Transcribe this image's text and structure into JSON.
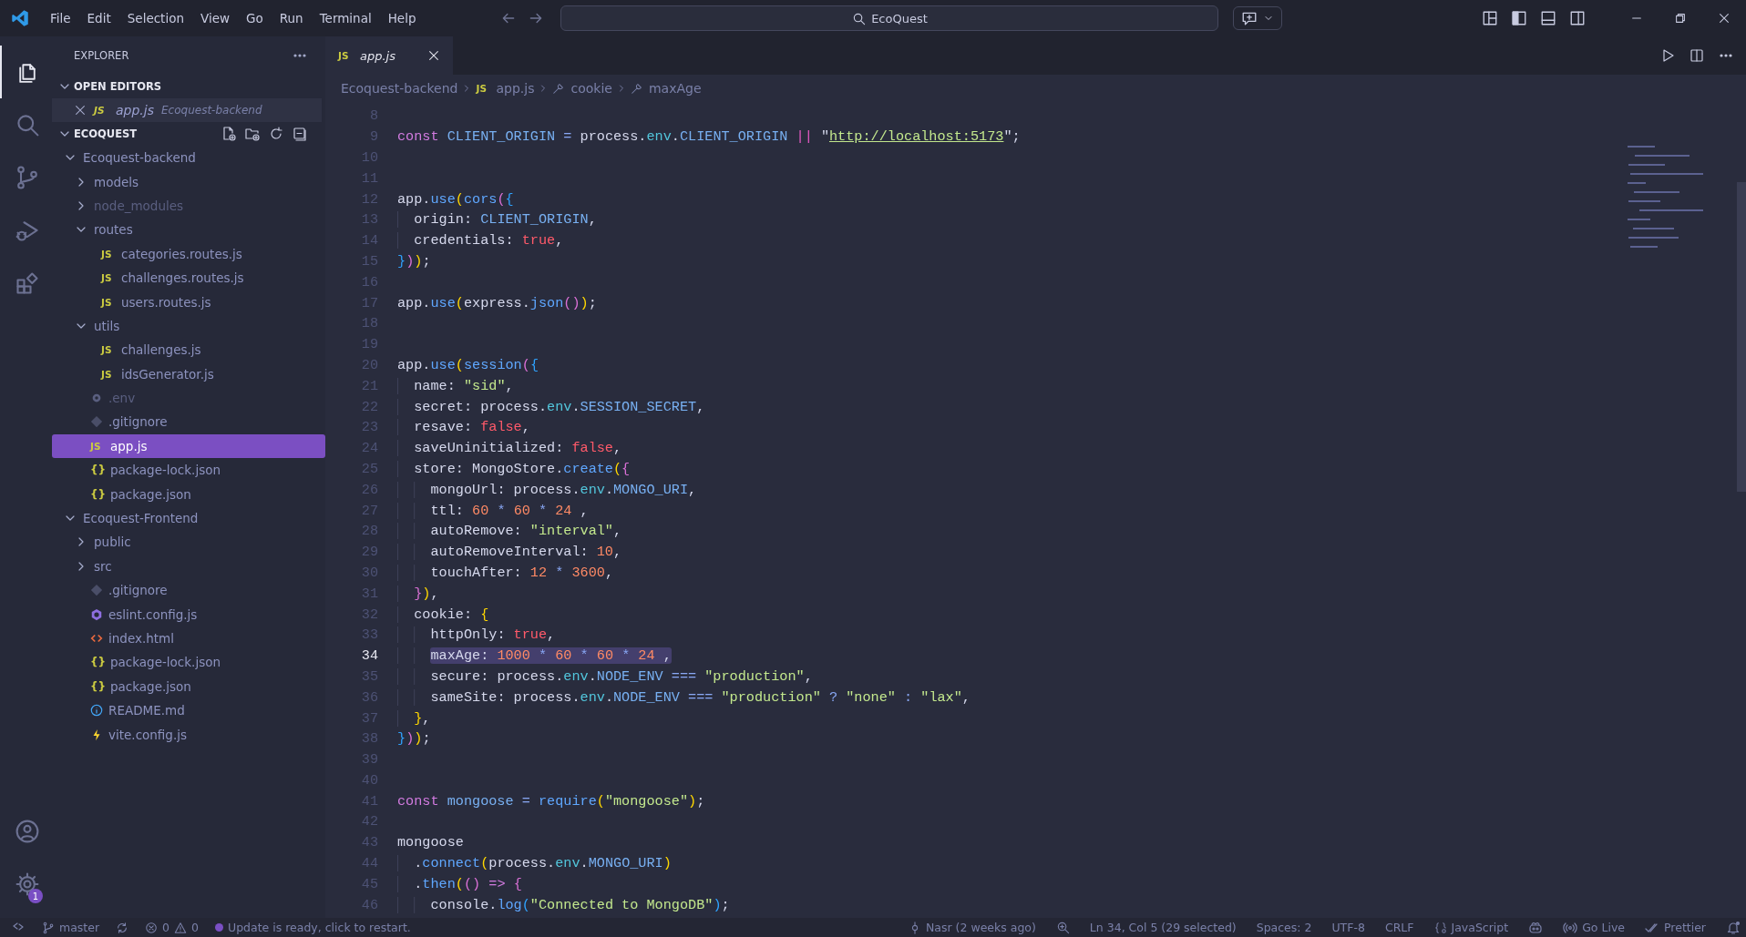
{
  "title_bar": {
    "menu": [
      "File",
      "Edit",
      "Selection",
      "View",
      "Go",
      "Run",
      "Terminal",
      "Help"
    ],
    "search": {
      "value": "EcoQuest"
    }
  },
  "activity_bar": {
    "items": [
      {
        "kind": "explorer",
        "selected": true
      },
      {
        "kind": "search",
        "selected": false
      },
      {
        "kind": "source-control",
        "selected": false
      },
      {
        "kind": "run-debug",
        "selected": false
      },
      {
        "kind": "extensions",
        "selected": false
      }
    ],
    "bottom": [
      {
        "kind": "account"
      },
      {
        "kind": "settings",
        "badge": "1"
      }
    ]
  },
  "sidebar": {
    "title": "EXPLORER",
    "open_editors": {
      "label": "OPEN EDITORS",
      "expanded": true,
      "items": [
        {
          "name": "app.js",
          "folder": "Ecoquest-backend",
          "kind": "js-file",
          "icon_text": "JS",
          "preview": true
        }
      ]
    },
    "workspace": {
      "label": "ECOQUEST",
      "expanded": true,
      "tree": [
        {
          "name": "Ecoquest-backend",
          "kind": "folder",
          "expanded": true,
          "ignored": false,
          "selected": false,
          "children": [
            {
              "name": "models",
              "kind": "folder",
              "expanded": false,
              "ignored": false,
              "selected": false
            },
            {
              "name": "node_modules",
              "kind": "folder",
              "expanded": false,
              "ignored": true,
              "selected": false
            },
            {
              "name": "routes",
              "kind": "folder",
              "expanded": true,
              "ignored": false,
              "selected": false,
              "children": [
                {
                  "name": "categories.routes.js",
                  "kind": "js-file",
                  "icon_text": "JS",
                  "ignored": false,
                  "selected": false
                },
                {
                  "name": "challenges.routes.js",
                  "kind": "js-file",
                  "icon_text": "JS",
                  "ignored": false,
                  "selected": false
                },
                {
                  "name": "users.routes.js",
                  "kind": "js-file",
                  "icon_text": "JS",
                  "ignored": false,
                  "selected": false
                }
              ]
            },
            {
              "name": "utils",
              "kind": "folder",
              "expanded": true,
              "ignored": false,
              "selected": false,
              "children": [
                {
                  "name": "challenges.js",
                  "kind": "js-file",
                  "icon_text": "JS",
                  "ignored": false,
                  "selected": false
                },
                {
                  "name": "idsGenerator.js",
                  "kind": "js-file",
                  "icon_text": "JS",
                  "ignored": false,
                  "selected": false
                }
              ]
            },
            {
              "name": ".env",
              "kind": "env-file",
              "ignored": true,
              "selected": false
            },
            {
              "name": ".gitignore",
              "kind": "git-file",
              "ignored": false,
              "selected": false
            },
            {
              "name": "app.js",
              "kind": "js-file",
              "icon_text": "JS",
              "ignored": false,
              "selected": true
            },
            {
              "name": "package-lock.json",
              "kind": "json-file",
              "icon_text": "{}",
              "ignored": false,
              "selected": false
            },
            {
              "name": "package.json",
              "kind": "json-file",
              "icon_text": "{}",
              "ignored": false,
              "selected": false
            }
          ]
        },
        {
          "name": "Ecoquest-Frontend",
          "kind": "folder",
          "expanded": true,
          "ignored": false,
          "selected": false,
          "children": [
            {
              "name": "public",
              "kind": "folder",
              "expanded": false,
              "ignored": false,
              "selected": false
            },
            {
              "name": "src",
              "kind": "folder",
              "expanded": false,
              "ignored": false,
              "selected": false
            },
            {
              "name": ".gitignore",
              "kind": "git-file",
              "ignored": false,
              "selected": false
            },
            {
              "name": "eslint.config.js",
              "kind": "eslint-file",
              "ignored": false,
              "selected": false
            },
            {
              "name": "index.html",
              "kind": "html-file",
              "ignored": false,
              "selected": false
            },
            {
              "name": "package-lock.json",
              "kind": "json-file",
              "icon_text": "{}",
              "ignored": false,
              "selected": false
            },
            {
              "name": "package.json",
              "kind": "json-file",
              "icon_text": "{}",
              "ignored": false,
              "selected": false
            },
            {
              "name": "README.md",
              "kind": "info-file",
              "ignored": false,
              "selected": false
            },
            {
              "name": "vite.config.js",
              "kind": "vite-file",
              "ignored": false,
              "selected": false
            }
          ]
        }
      ]
    }
  },
  "tabs": [
    {
      "label": "app.js",
      "icon_text": "JS",
      "selected": true,
      "preview": true
    }
  ],
  "breadcrumb": [
    {
      "kind": "folder",
      "text": "Ecoquest-backend"
    },
    {
      "kind": "file",
      "icon_text": "JS",
      "text": "app.js"
    },
    {
      "kind": "symbol",
      "text": "cookie"
    },
    {
      "kind": "symbol",
      "text": "maxAge"
    }
  ],
  "code": [
    {
      "number": "8",
      "selected": false
    },
    {
      "number": "9",
      "selected": false,
      "tokens": [
        {
          "kind": "keyword",
          "text": "const "
        },
        {
          "kind": "variable",
          "text": "CLIENT_ORIGIN "
        },
        {
          "kind": "operator",
          "text": "="
        },
        {
          "kind": "plain",
          "text": " process."
        },
        {
          "kind": "member",
          "text": "env"
        },
        {
          "kind": "plain",
          "text": "."
        },
        {
          "kind": "variable",
          "text": "CLIENT_ORIGIN "
        },
        {
          "kind": "logic",
          "text": "||"
        },
        {
          "kind": "plain",
          "text": " \""
        },
        {
          "kind": "link",
          "text": "http://localhost:5173"
        },
        {
          "kind": "plain",
          "text": "\";"
        }
      ]
    },
    {
      "number": "10",
      "selected": false
    },
    {
      "number": "11",
      "selected": false
    },
    {
      "number": "12",
      "selected": false,
      "tokens": [
        {
          "kind": "plain",
          "text": "app."
        },
        {
          "kind": "function",
          "text": "use"
        },
        {
          "kind": "bracket1",
          "text": "("
        },
        {
          "kind": "function",
          "text": "cors"
        },
        {
          "kind": "bracket2",
          "text": "("
        },
        {
          "kind": "bracket3",
          "text": "{"
        }
      ]
    },
    {
      "number": "13",
      "selected": false,
      "tokens": [
        {
          "kind": "plain",
          "text": "  origin: "
        },
        {
          "kind": "variable",
          "text": "CLIENT_ORIGIN"
        },
        {
          "kind": "plain",
          "text": ","
        }
      ]
    },
    {
      "number": "14",
      "selected": false,
      "tokens": [
        {
          "kind": "plain",
          "text": "  credentials: "
        },
        {
          "kind": "boolean",
          "text": "true"
        },
        {
          "kind": "plain",
          "text": ","
        }
      ]
    },
    {
      "number": "15",
      "selected": false,
      "tokens": [
        {
          "kind": "bracket3",
          "text": "}"
        },
        {
          "kind": "bracket2",
          "text": ")"
        },
        {
          "kind": "bracket1",
          "text": ")"
        },
        {
          "kind": "plain",
          "text": ";"
        }
      ]
    },
    {
      "number": "16",
      "selected": false
    },
    {
      "number": "17",
      "selected": false,
      "tokens": [
        {
          "kind": "plain",
          "text": "app."
        },
        {
          "kind": "function",
          "text": "use"
        },
        {
          "kind": "bracket1",
          "text": "("
        },
        {
          "kind": "plain",
          "text": "express."
        },
        {
          "kind": "function",
          "text": "json"
        },
        {
          "kind": "bracket2",
          "text": "()"
        },
        {
          "kind": "bracket1",
          "text": ")"
        },
        {
          "kind": "plain",
          "text": ";"
        }
      ]
    },
    {
      "number": "18",
      "selected": false
    },
    {
      "number": "19",
      "selected": false
    },
    {
      "number": "20",
      "selected": false,
      "tokens": [
        {
          "kind": "plain",
          "text": "app."
        },
        {
          "kind": "function",
          "text": "use"
        },
        {
          "kind": "bracket1",
          "text": "("
        },
        {
          "kind": "function",
          "text": "session"
        },
        {
          "kind": "bracket2",
          "text": "("
        },
        {
          "kind": "bracket3",
          "text": "{"
        }
      ]
    },
    {
      "number": "21",
      "selected": false,
      "tokens": [
        {
          "kind": "plain",
          "text": "  name: "
        },
        {
          "kind": "string",
          "text": "\"sid\""
        },
        {
          "kind": "plain",
          "text": ","
        }
      ]
    },
    {
      "number": "22",
      "selected": false,
      "tokens": [
        {
          "kind": "plain",
          "text": "  secret: process."
        },
        {
          "kind": "member",
          "text": "env"
        },
        {
          "kind": "plain",
          "text": "."
        },
        {
          "kind": "variable",
          "text": "SESSION_SECRET"
        },
        {
          "kind": "plain",
          "text": ","
        }
      ]
    },
    {
      "number": "23",
      "selected": false,
      "tokens": [
        {
          "kind": "plain",
          "text": "  resave: "
        },
        {
          "kind": "boolean",
          "text": "false"
        },
        {
          "kind": "plain",
          "text": ","
        }
      ]
    },
    {
      "number": "24",
      "selected": false,
      "tokens": [
        {
          "kind": "plain",
          "text": "  saveUninitialized: "
        },
        {
          "kind": "boolean",
          "text": "false"
        },
        {
          "kind": "plain",
          "text": ","
        }
      ]
    },
    {
      "number": "25",
      "selected": false,
      "tokens": [
        {
          "kind": "plain",
          "text": "  store: MongoStore."
        },
        {
          "kind": "function",
          "text": "create"
        },
        {
          "kind": "bracket1",
          "text": "("
        },
        {
          "kind": "bracket2",
          "text": "{"
        }
      ]
    },
    {
      "number": "26",
      "selected": false,
      "tokens": [
        {
          "kind": "plain",
          "text": "    mongoUrl: process."
        },
        {
          "kind": "member",
          "text": "env"
        },
        {
          "kind": "plain",
          "text": "."
        },
        {
          "kind": "variable",
          "text": "MONGO_URI"
        },
        {
          "kind": "plain",
          "text": ","
        }
      ]
    },
    {
      "number": "27",
      "selected": false,
      "tokens": [
        {
          "kind": "plain",
          "text": "    ttl: "
        },
        {
          "kind": "number",
          "text": "60 "
        },
        {
          "kind": "operator",
          "text": "* "
        },
        {
          "kind": "number",
          "text": "60 "
        },
        {
          "kind": "operator",
          "text": "* "
        },
        {
          "kind": "number",
          "text": "24"
        },
        {
          "kind": "plain",
          "text": " ,"
        }
      ]
    },
    {
      "number": "28",
      "selected": false,
      "tokens": [
        {
          "kind": "plain",
          "text": "    autoRemove: "
        },
        {
          "kind": "string",
          "text": "\"interval\""
        },
        {
          "kind": "plain",
          "text": ","
        }
      ]
    },
    {
      "number": "29",
      "selected": false,
      "tokens": [
        {
          "kind": "plain",
          "text": "    autoRemoveInterval: "
        },
        {
          "kind": "number",
          "text": "10"
        },
        {
          "kind": "plain",
          "text": ","
        }
      ]
    },
    {
      "number": "30",
      "selected": false,
      "tokens": [
        {
          "kind": "plain",
          "text": "    touchAfter: "
        },
        {
          "kind": "number",
          "text": "12 "
        },
        {
          "kind": "operator",
          "text": "* "
        },
        {
          "kind": "number",
          "text": "3600"
        },
        {
          "kind": "plain",
          "text": ","
        }
      ]
    },
    {
      "number": "31",
      "selected": false,
      "tokens": [
        {
          "kind": "bracket2",
          "text": "  }"
        },
        {
          "kind": "bracket1",
          "text": ")"
        },
        {
          "kind": "plain",
          "text": ","
        }
      ]
    },
    {
      "number": "32",
      "selected": false,
      "tokens": [
        {
          "kind": "plain",
          "text": "  cookie: "
        },
        {
          "kind": "bracket1",
          "text": "{"
        }
      ]
    },
    {
      "number": "33",
      "selected": false,
      "tokens": [
        {
          "kind": "plain",
          "text": "    httpOnly: "
        },
        {
          "kind": "boolean",
          "text": "true"
        },
        {
          "kind": "plain",
          "text": ","
        }
      ]
    },
    {
      "number": "34",
      "selected": true,
      "tokens": [
        {
          "kind": "plain",
          "text": "    maxAge: "
        },
        {
          "kind": "number",
          "text": "1000 "
        },
        {
          "kind": "operator",
          "text": "* "
        },
        {
          "kind": "number",
          "text": "60 "
        },
        {
          "kind": "operator",
          "text": "* "
        },
        {
          "kind": "number",
          "text": "60 "
        },
        {
          "kind": "operator",
          "text": "* "
        },
        {
          "kind": "number",
          "text": "24"
        },
        {
          "kind": "plain",
          "text": " ,"
        }
      ]
    },
    {
      "number": "35",
      "selected": false,
      "tokens": [
        {
          "kind": "plain",
          "text": "    secure: process."
        },
        {
          "kind": "member",
          "text": "env"
        },
        {
          "kind": "plain",
          "text": "."
        },
        {
          "kind": "variable",
          "text": "NODE_ENV "
        },
        {
          "kind": "operator",
          "text": "==="
        },
        {
          "kind": "string",
          "text": " \"production\""
        },
        {
          "kind": "plain",
          "text": ","
        }
      ]
    },
    {
      "number": "36",
      "selected": false,
      "tokens": [
        {
          "kind": "plain",
          "text": "    sameSite: process."
        },
        {
          "kind": "member",
          "text": "env"
        },
        {
          "kind": "plain",
          "text": "."
        },
        {
          "kind": "variable",
          "text": "NODE_ENV "
        },
        {
          "kind": "operator",
          "text": "==="
        },
        {
          "kind": "string",
          "text": " \"production\" "
        },
        {
          "kind": "operator",
          "text": "?"
        },
        {
          "kind": "string",
          "text": " \"none\" "
        },
        {
          "kind": "operator",
          "text": ":"
        },
        {
          "kind": "string",
          "text": " \"lax\""
        },
        {
          "kind": "plain",
          "text": ","
        }
      ]
    },
    {
      "number": "37",
      "selected": false,
      "tokens": [
        {
          "kind": "bracket1",
          "text": "  }"
        },
        {
          "kind": "plain",
          "text": ","
        }
      ]
    },
    {
      "number": "38",
      "selected": false,
      "tokens": [
        {
          "kind": "bracket3",
          "text": "}"
        },
        {
          "kind": "bracket2",
          "text": ")"
        },
        {
          "kind": "bracket1",
          "text": ")"
        },
        {
          "kind": "plain",
          "text": ";"
        }
      ]
    },
    {
      "number": "39",
      "selected": false
    },
    {
      "number": "40",
      "selected": false
    },
    {
      "number": "41",
      "selected": false,
      "tokens": [
        {
          "kind": "keyword",
          "text": "const "
        },
        {
          "kind": "variable",
          "text": "mongoose "
        },
        {
          "kind": "operator",
          "text": "= "
        },
        {
          "kind": "function",
          "text": "require"
        },
        {
          "kind": "bracket1",
          "text": "("
        },
        {
          "kind": "string",
          "text": "\"mongoose\""
        },
        {
          "kind": "bracket1",
          "text": ")"
        },
        {
          "kind": "plain",
          "text": ";"
        }
      ]
    },
    {
      "number": "42",
      "selected": false
    },
    {
      "number": "43",
      "selected": false,
      "tokens": [
        {
          "kind": "plain",
          "text": "mongoose"
        }
      ]
    },
    {
      "number": "44",
      "selected": false,
      "tokens": [
        {
          "kind": "plain",
          "text": "  ."
        },
        {
          "kind": "function",
          "text": "connect"
        },
        {
          "kind": "bracket1",
          "text": "("
        },
        {
          "kind": "plain",
          "text": "process."
        },
        {
          "kind": "member",
          "text": "env"
        },
        {
          "kind": "plain",
          "text": "."
        },
        {
          "kind": "variable",
          "text": "MONGO_URI"
        },
        {
          "kind": "bracket1",
          "text": ")"
        }
      ]
    },
    {
      "number": "45",
      "selected": false,
      "tokens": [
        {
          "kind": "plain",
          "text": "  ."
        },
        {
          "kind": "function",
          "text": "then"
        },
        {
          "kind": "bracket1",
          "text": "("
        },
        {
          "kind": "bracket2",
          "text": "() "
        },
        {
          "kind": "keyword",
          "text": "=> "
        },
        {
          "kind": "bracket2",
          "text": "{"
        }
      ]
    },
    {
      "number": "46",
      "selected": false,
      "tokens": [
        {
          "kind": "plain",
          "text": "    console."
        },
        {
          "kind": "function",
          "text": "log"
        },
        {
          "kind": "bracket3",
          "text": "("
        },
        {
          "kind": "string",
          "text": "\"Connected to MongoDB\""
        },
        {
          "kind": "bracket3",
          "text": ")"
        },
        {
          "kind": "plain",
          "text": ";"
        }
      ]
    }
  ],
  "status_bar": {
    "left": [
      {
        "kind": "remote"
      },
      {
        "kind": "branch",
        "text": "master"
      },
      {
        "kind": "sync"
      },
      {
        "kind": "problems",
        "errors": "0",
        "warnings": "0"
      },
      {
        "kind": "notice",
        "text": "Update is ready, click to restart."
      }
    ],
    "right": [
      {
        "kind": "blame",
        "text": "Nasr (2 weeks ago)"
      },
      {
        "kind": "zoom"
      },
      {
        "kind": "text",
        "text": "Ln 34, Col 5 (29 selected)"
      },
      {
        "kind": "text",
        "text": "Spaces: 2"
      },
      {
        "kind": "text",
        "text": "UTF-8"
      },
      {
        "kind": "text",
        "text": "CRLF"
      },
      {
        "kind": "language",
        "text": "JavaScript"
      },
      {
        "kind": "copilot"
      },
      {
        "kind": "golive",
        "text": "Go Live"
      },
      {
        "kind": "prettier",
        "text": "Prettier"
      },
      {
        "kind": "bell"
      }
    ]
  }
}
